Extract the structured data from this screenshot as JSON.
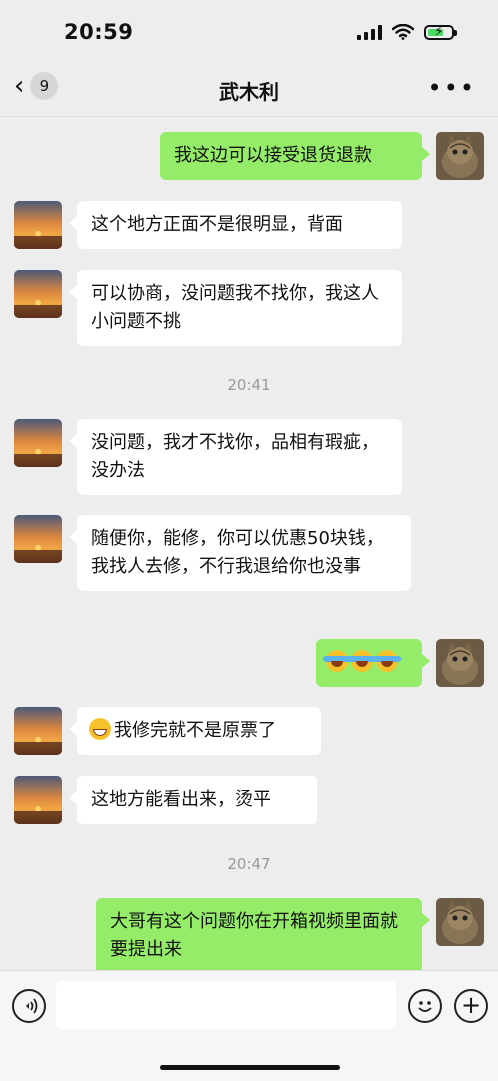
{
  "status": {
    "time": "20:59"
  },
  "header": {
    "back_badge": "9",
    "title": "武木利",
    "more_icon": "more-icon"
  },
  "messages": [
    {
      "side": "me",
      "text": "我这边可以接受退货退款"
    },
    {
      "side": "peer",
      "text": "这个地方正面不是很明显，背面"
    },
    {
      "side": "peer",
      "text": "可以协商，没问题我不找你，我这人小问题不挑"
    },
    {
      "side": "time",
      "text": "20:41"
    },
    {
      "side": "peer",
      "text": "没问题，我才不找你，品相有瑕疵，没办法"
    },
    {
      "side": "peer",
      "text": "随便你，能修，你可以优惠50块钱，我找人去修，不行我退给你也没事"
    },
    {
      "side": "me",
      "text": "",
      "emojis": [
        "crying-laughing",
        "crying-laughing",
        "crying-laughing"
      ]
    },
    {
      "side": "peer",
      "text": "我修完就不是原票了",
      "emojis": [
        "grinning"
      ]
    },
    {
      "side": "peer",
      "text": "这地方能看出来，烫平"
    },
    {
      "side": "time",
      "text": "20:47"
    },
    {
      "side": "me",
      "text": "大哥有这个问题你在开箱视频里面就要提出来"
    }
  ],
  "input": {
    "value": "",
    "placeholder": ""
  },
  "colors": {
    "me_bubble": "#95ec69",
    "peer_bubble": "#ffffff",
    "background": "#ededed"
  }
}
